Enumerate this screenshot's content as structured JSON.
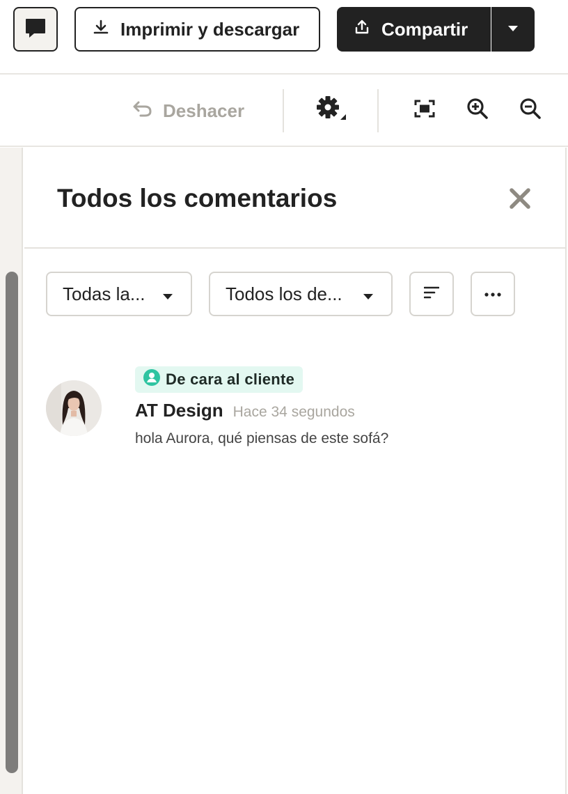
{
  "header": {
    "print_label": "Imprimir y descargar",
    "share_label": "Compartir"
  },
  "toolbar": {
    "undo_label": "Deshacer"
  },
  "panel": {
    "title": "Todos los comentarios",
    "filters": {
      "visibility_value": "Todas la...",
      "scope_value": "Todos los de..."
    }
  },
  "comments": [
    {
      "badge": "De cara al cliente",
      "author": "AT Design",
      "time": "Hace 34 segundos",
      "text": "hola Aurora, qué piensas de este sofá?"
    }
  ],
  "colors": {
    "dark": "#222222",
    "badge_bg": "#e3f8f1",
    "badge_icon": "#2ec4a1",
    "muted": "#a9a69f"
  },
  "icons": [
    "comment-icon",
    "download-icon",
    "upload-icon",
    "caret-down-icon",
    "undo-icon",
    "gear-icon",
    "fit-screen-icon",
    "zoom-in-icon",
    "zoom-out-icon",
    "close-icon",
    "sort-icon",
    "more-icon",
    "user-icon"
  ]
}
